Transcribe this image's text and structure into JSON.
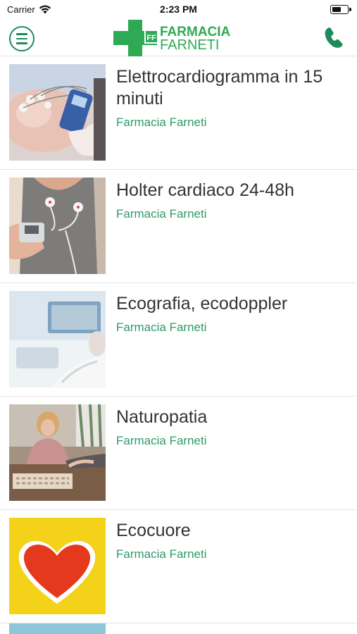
{
  "status_bar": {
    "carrier": "Carrier",
    "time": "2:23 PM"
  },
  "header": {
    "logo_line1": "FARMACIA",
    "logo_line2": "FARNETI",
    "logo_badge": "FF",
    "brand_color": "#1f8a5b",
    "logo_green": "#2eaa55"
  },
  "services": [
    {
      "title": " Elettrocardiogramma in 15 minuti",
      "subtitle": "Farmacia Farneti"
    },
    {
      "title": " Holter cardiaco 24-48h",
      "subtitle": "Farmacia Farneti"
    },
    {
      "title": "Ecografia, ecodoppler",
      "subtitle": "Farmacia Farneti"
    },
    {
      "title": "Naturopatia",
      "subtitle": "Farmacia Farneti"
    },
    {
      "title": "Ecocuore",
      "subtitle": "Farmacia Farneti"
    }
  ]
}
